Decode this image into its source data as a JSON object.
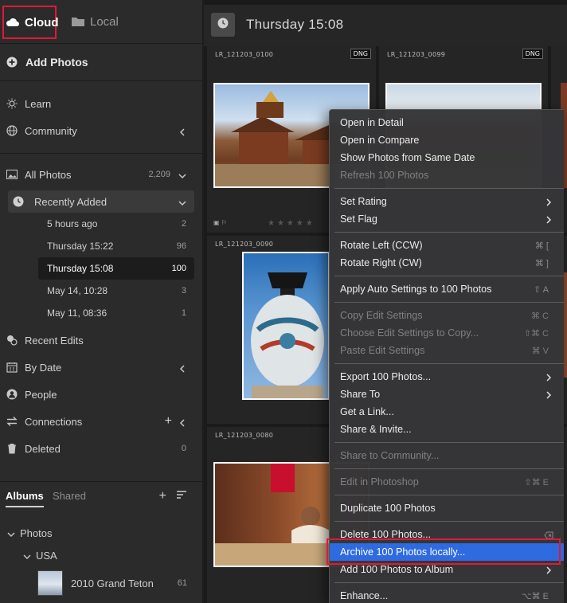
{
  "sidebar": {
    "tabs": {
      "cloud": "Cloud",
      "local": "Local"
    },
    "add_photos": "Add Photos",
    "learn": "Learn",
    "community": "Community",
    "all_photos": {
      "label": "All Photos",
      "count": "2,209"
    },
    "recently_added": "Recently Added",
    "recent_items": [
      {
        "label": "5 hours ago",
        "count": "2"
      },
      {
        "label": "Thursday  15:22",
        "count": "96"
      },
      {
        "label": "Thursday  15:08",
        "count": "100"
      },
      {
        "label": "May 14, 10:28",
        "count": "3"
      },
      {
        "label": "May 11, 08:36",
        "count": "1"
      }
    ],
    "recent_edits": "Recent Edits",
    "by_date": "By Date",
    "people": "People",
    "connections": "Connections",
    "deleted": {
      "label": "Deleted",
      "count": "0"
    },
    "albums_tab": "Albums",
    "shared_tab": "Shared",
    "tree": {
      "photos": "Photos",
      "usa": "USA",
      "album": {
        "label": "2010 Grand Teton",
        "count": "61"
      }
    }
  },
  "main": {
    "title": "Thursday  15:08",
    "cells": [
      {
        "name": "LR_121203_0100",
        "badge": "DNG"
      },
      {
        "name": "LR_121203_0099",
        "badge": "DNG"
      },
      {
        "name": "LR_121203_0090"
      },
      {
        "name": "LR_121203_0080"
      }
    ],
    "stars": "★★★★★"
  },
  "context_menu": {
    "items": [
      {
        "label": "Open in Detail"
      },
      {
        "label": "Open in Compare"
      },
      {
        "label": "Show Photos from Same Date"
      },
      {
        "label": "Refresh 100 Photos",
        "disabled": true
      },
      {
        "label": "Set Rating"
      },
      {
        "label": "Set Flag"
      },
      {
        "label": "Rotate Left (CCW)",
        "shortcut": "⌘ ["
      },
      {
        "label": "Rotate Right (CW)",
        "shortcut": "⌘ ]"
      },
      {
        "label": "Apply Auto Settings to 100 Photos",
        "shortcut": "⇧ A"
      },
      {
        "label": "Copy Edit Settings",
        "shortcut": "⌘ C",
        "disabled": true
      },
      {
        "label": "Choose Edit Settings to Copy...",
        "shortcut": "⇧⌘ C",
        "disabled": true
      },
      {
        "label": "Paste Edit Settings",
        "shortcut": "⌘ V",
        "disabled": true
      },
      {
        "label": "Export 100 Photos..."
      },
      {
        "label": "Share To"
      },
      {
        "label": "Get a Link..."
      },
      {
        "label": "Share & Invite..."
      },
      {
        "label": "Share to Community...",
        "disabled": true
      },
      {
        "label": "Edit in Photoshop",
        "shortcut": "⇧⌘ E",
        "disabled": true
      },
      {
        "label": "Duplicate 100 Photos"
      },
      {
        "label": "Delete 100 Photos..."
      },
      {
        "label": "Archive 100 Photos locally...",
        "highlighted": true
      },
      {
        "label": "Add 100 Photos to Album"
      },
      {
        "label": "Enhance...",
        "shortcut": "⌥⌘ E"
      }
    ]
  },
  "colors": {
    "highlight": "#2e6ae0",
    "callout": "#e0183a"
  }
}
